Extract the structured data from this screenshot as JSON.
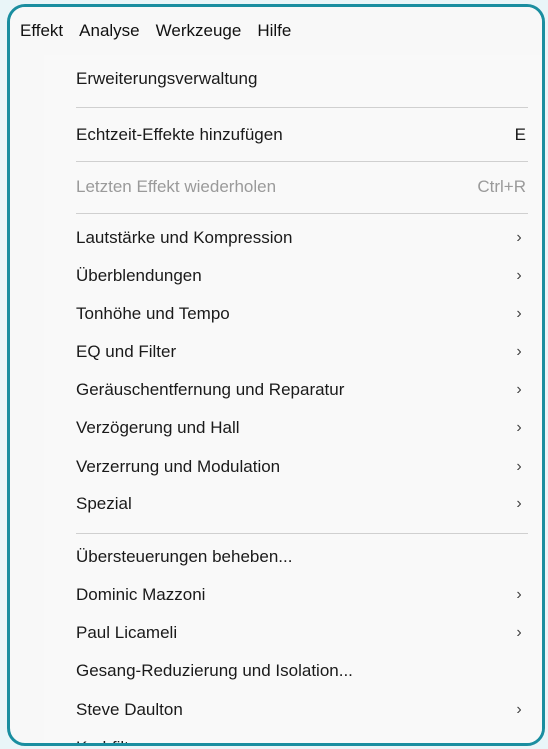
{
  "menubar": {
    "items": [
      {
        "label": "Effekt"
      },
      {
        "label": "Analyse"
      },
      {
        "label": "Werkzeuge"
      },
      {
        "label": "Hilfe"
      }
    ]
  },
  "menu": {
    "items": [
      {
        "label": "Erweiterungsverwaltung",
        "shortcut": "",
        "submenu": false,
        "disabled": false
      },
      {
        "label": "Echtzeit-Effekte hinzufügen",
        "shortcut": "E",
        "submenu": false,
        "disabled": false
      },
      {
        "label": "Letzten Effekt wiederholen",
        "shortcut": "Ctrl+R",
        "submenu": false,
        "disabled": true
      },
      {
        "label": "Lautstärke und Kompression",
        "shortcut": "",
        "submenu": true,
        "disabled": false
      },
      {
        "label": "Überblendungen",
        "shortcut": "",
        "submenu": true,
        "disabled": false
      },
      {
        "label": "Tonhöhe und Tempo",
        "shortcut": "",
        "submenu": true,
        "disabled": false
      },
      {
        "label": "EQ und Filter",
        "shortcut": "",
        "submenu": true,
        "disabled": false
      },
      {
        "label": "Geräuschentfernung und Reparatur",
        "shortcut": "",
        "submenu": true,
        "disabled": false
      },
      {
        "label": "Verzögerung und Hall",
        "shortcut": "",
        "submenu": true,
        "disabled": false
      },
      {
        "label": "Verzerrung und Modulation",
        "shortcut": "",
        "submenu": true,
        "disabled": false
      },
      {
        "label": "Spezial",
        "shortcut": "",
        "submenu": true,
        "disabled": false
      },
      {
        "label": "Übersteuerungen beheben...",
        "shortcut": "",
        "submenu": false,
        "disabled": false
      },
      {
        "label": "Dominic Mazzoni",
        "shortcut": "",
        "submenu": true,
        "disabled": false
      },
      {
        "label": "Paul Licameli",
        "shortcut": "",
        "submenu": true,
        "disabled": false
      },
      {
        "label": "Gesang-Reduzierung und Isolation...",
        "shortcut": "",
        "submenu": false,
        "disabled": false
      },
      {
        "label": "Steve Daulton",
        "shortcut": "",
        "submenu": true,
        "disabled": false
      },
      {
        "label": "Kerbfilter...",
        "shortcut": "",
        "submenu": false,
        "disabled": false
      }
    ],
    "chevron_glyph": "›"
  }
}
